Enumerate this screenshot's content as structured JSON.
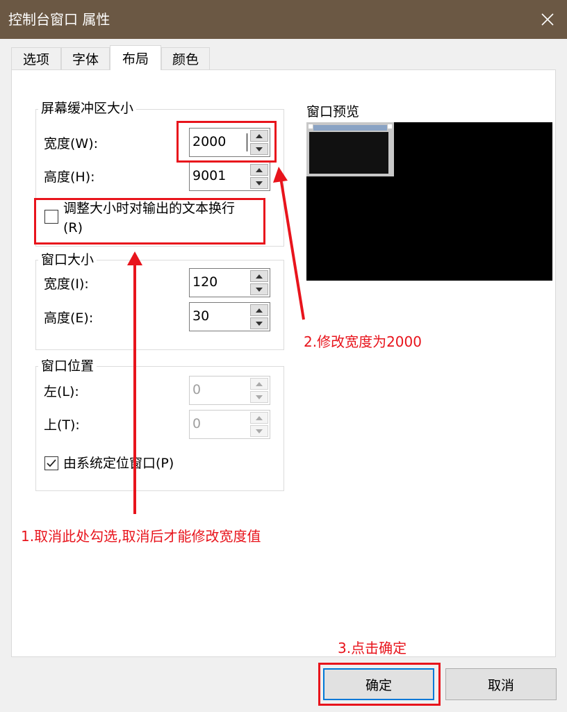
{
  "window": {
    "title": "控制台窗口 属性"
  },
  "tabs": [
    {
      "label": "选项",
      "active": false
    },
    {
      "label": "字体",
      "active": false
    },
    {
      "label": "布局",
      "active": true
    },
    {
      "label": "颜色",
      "active": false
    }
  ],
  "buffer_size": {
    "title": "屏幕缓冲区大小",
    "width_label": "宽度(W):",
    "width_value": "2000",
    "height_label": "高度(H):",
    "height_value": "9001",
    "wrap_label_line1": "调整大小时对输出的文本换行",
    "wrap_label_line2": "(R)",
    "wrap_checked": false
  },
  "window_size": {
    "title": "窗口大小",
    "width_label": "宽度(I):",
    "width_value": "120",
    "height_label": "高度(E):",
    "height_value": "30"
  },
  "window_position": {
    "title": "窗口位置",
    "left_label": "左(L):",
    "left_value": "0",
    "top_label": "上(T):",
    "top_value": "0",
    "system_position_label": "由系统定位窗口(P)",
    "system_position_checked": true
  },
  "preview": {
    "label": "窗口预览"
  },
  "annotations": {
    "step1": "1.取消此处勾选,取消后才能修改宽度值",
    "step2": "2.修改宽度为2000",
    "step3": "3.点击确定"
  },
  "buttons": {
    "ok": "确定",
    "cancel": "取消"
  },
  "colors": {
    "annotation": "#e8141c",
    "titlebar": "#6b5844",
    "focus": "#0078d7"
  }
}
